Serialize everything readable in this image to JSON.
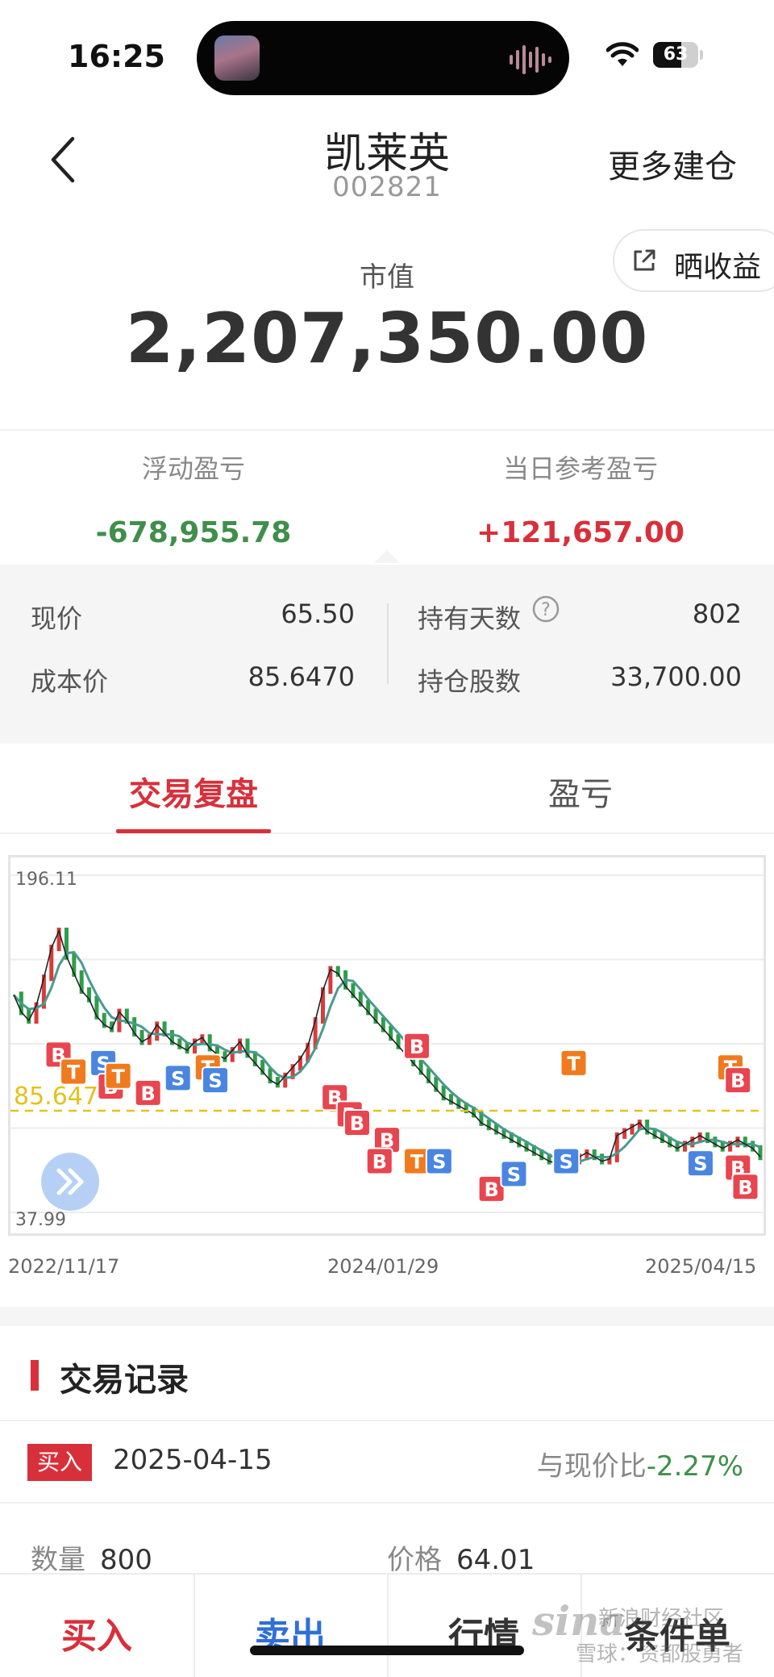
{
  "status_bar": {
    "time": "16:25",
    "battery": "63",
    "battery_level": 0.63
  },
  "nav": {
    "title": "凯莱英",
    "code": "002821",
    "more_label": "更多建仓"
  },
  "header": {
    "share_label": "晒收益",
    "market_value_label": "市值",
    "market_value": "2,207,350.00"
  },
  "pnl": {
    "floating_label": "浮动盈亏",
    "floating_value": "-678,955.78",
    "daily_label": "当日参考盈亏",
    "daily_value": "+121,657.00"
  },
  "details": {
    "price_label": "现价",
    "price": "65.50",
    "cost_label": "成本价",
    "cost": "85.6470",
    "days_label": "持有天数",
    "days": "802",
    "shares_label": "持仓股数",
    "shares": "33,700.00"
  },
  "tabs": [
    {
      "label": "交易复盘",
      "active": true
    },
    {
      "label": "盈亏",
      "active": false
    }
  ],
  "chart_data": {
    "type": "line",
    "y_max_label": "196.11",
    "y_min_label": "37.99",
    "cost_line_label": "85.647",
    "cost_line_value": 85.647,
    "ylim": [
      37.99,
      196.11
    ],
    "x_labels": [
      "2022/11/17",
      "2024/01/29",
      "2025/04/15"
    ],
    "price_series": [
      140,
      132,
      128,
      135,
      148,
      162,
      170,
      158,
      150,
      142,
      138,
      130,
      126,
      124,
      132,
      128,
      122,
      118,
      120,
      126,
      122,
      118,
      116,
      114,
      118,
      120,
      115,
      112,
      110,
      114,
      118,
      112,
      108,
      104,
      100,
      98,
      102,
      106,
      110,
      116,
      128,
      142,
      152,
      150,
      144,
      140,
      136,
      132,
      128,
      124,
      120,
      116,
      112,
      108,
      104,
      100,
      96,
      92,
      90,
      88,
      86,
      84,
      80,
      78,
      76,
      74,
      72,
      70,
      68,
      66,
      64,
      62,
      61,
      60,
      62,
      64,
      66,
      64,
      62,
      63,
      74,
      76,
      78,
      80,
      76,
      74,
      72,
      70,
      68,
      70,
      72,
      74,
      72,
      70,
      68,
      70,
      72,
      70,
      68,
      64
    ],
    "markers": [
      {
        "t": "B",
        "x": 6,
        "y": 112
      },
      {
        "t": "T",
        "x": 8,
        "y": 104
      },
      {
        "t": "S",
        "x": 12,
        "y": 108
      },
      {
        "t": "B",
        "x": 13,
        "y": 97
      },
      {
        "t": "T",
        "x": 14,
        "y": 102
      },
      {
        "t": "B",
        "x": 18,
        "y": 94
      },
      {
        "t": "S",
        "x": 22,
        "y": 101
      },
      {
        "t": "T",
        "x": 26,
        "y": 106
      },
      {
        "t": "S",
        "x": 27,
        "y": 100
      },
      {
        "t": "B",
        "x": 43,
        "y": 92
      },
      {
        "t": "B",
        "x": 45,
        "y": 84
      },
      {
        "t": "B",
        "x": 46,
        "y": 80
      },
      {
        "t": "B",
        "x": 54,
        "y": 116
      },
      {
        "t": "B",
        "x": 50,
        "y": 72
      },
      {
        "t": "B",
        "x": 49,
        "y": 62
      },
      {
        "t": "T",
        "x": 54,
        "y": 62
      },
      {
        "t": "S",
        "x": 57,
        "y": 62
      },
      {
        "t": "B",
        "x": 64,
        "y": 49
      },
      {
        "t": "S",
        "x": 67,
        "y": 56
      },
      {
        "t": "T",
        "x": 75,
        "y": 108
      },
      {
        "t": "S",
        "x": 74,
        "y": 62
      },
      {
        "t": "S",
        "x": 92,
        "y": 61
      },
      {
        "t": "T",
        "x": 96,
        "y": 106
      },
      {
        "t": "B",
        "x": 97,
        "y": 100
      },
      {
        "t": "B",
        "x": 97,
        "y": 59
      },
      {
        "t": "B",
        "x": 98,
        "y": 50
      }
    ],
    "marker_colors": {
      "B": "#e8454f",
      "S": "#4a86e0",
      "T": "#f07a1e"
    },
    "price_color": "#c8333a",
    "ma_color": "#4a9a8e",
    "cost_line_color": "#e4c21c"
  },
  "records": {
    "title": "交易记录",
    "items": [
      {
        "type": "买入",
        "date": "2025-04-15",
        "compare_label": "与现价比",
        "compare_value": "-2.27%",
        "qty_label": "数量",
        "qty": "800",
        "price_label": "价格",
        "price": "64.01"
      }
    ]
  },
  "bottom_bar": {
    "buy": "买入",
    "sell": "卖出",
    "quote": "行情",
    "condition": "条件单"
  },
  "watermark": {
    "logo": "sina",
    "line1": "新浪财经社区",
    "line2": "雪球：资都股勇者"
  }
}
